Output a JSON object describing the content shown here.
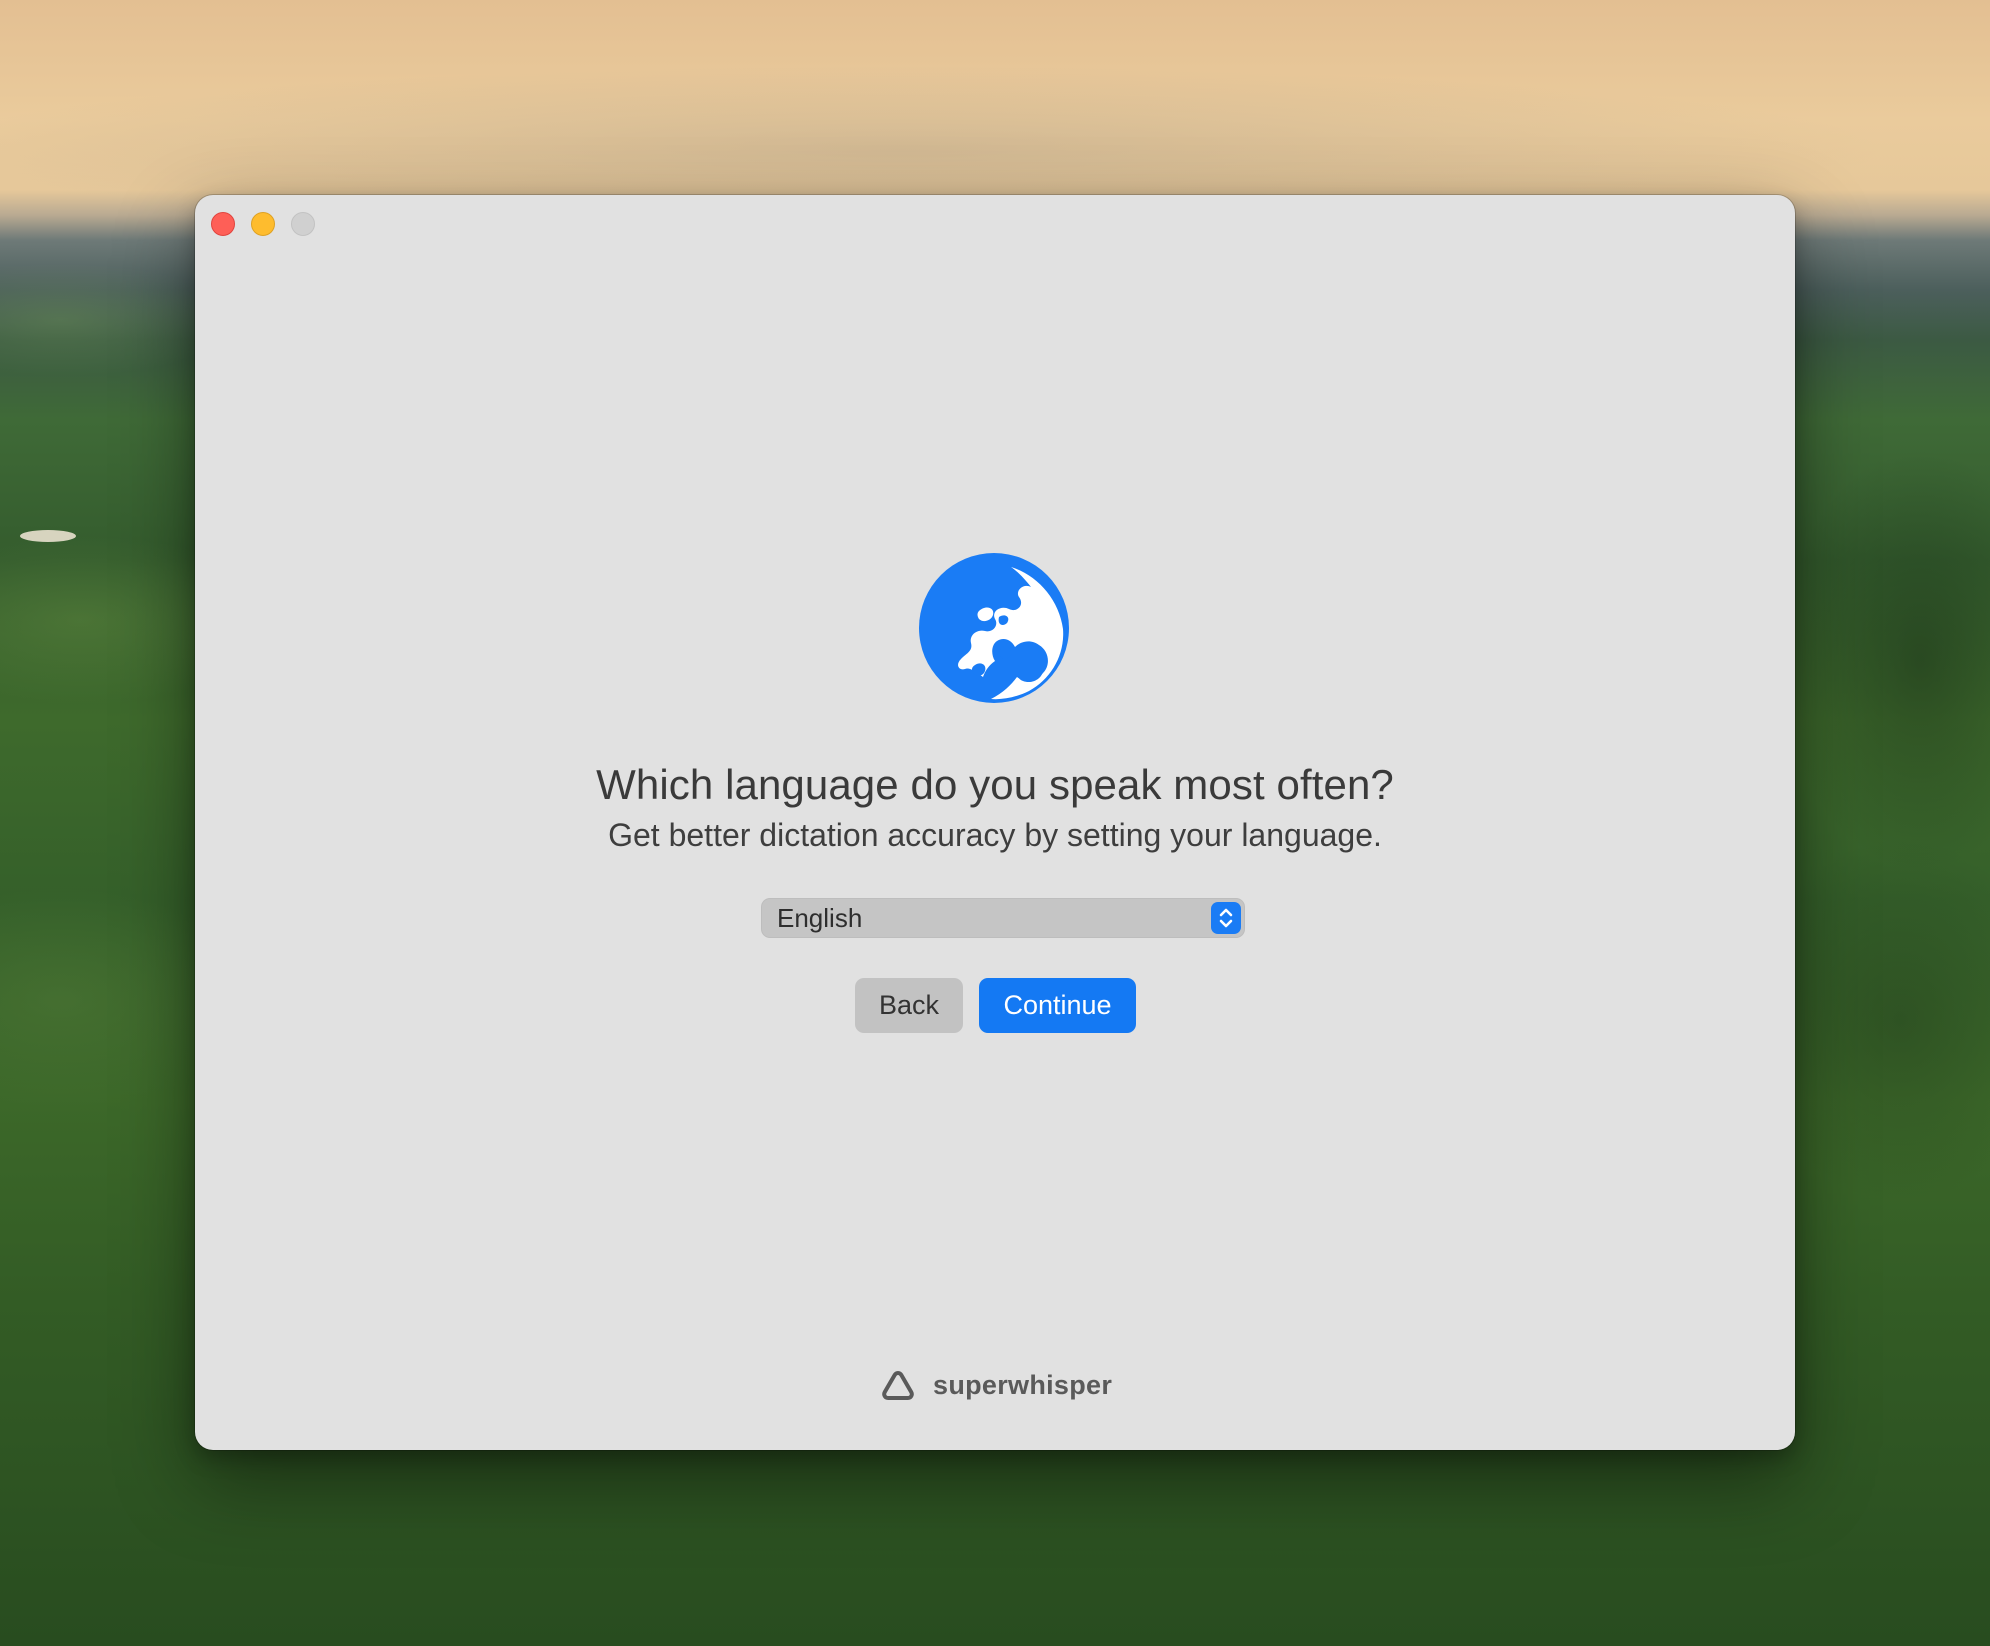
{
  "window": {
    "controls": [
      "close",
      "minimize",
      "zoom"
    ]
  },
  "onboarding": {
    "icon": "globe-icon",
    "title": "Which language do you speak most often?",
    "subtitle": "Get better dictation accuracy by setting your language.",
    "language_select": {
      "selected": "English"
    },
    "back_label": "Back",
    "continue_label": "Continue"
  },
  "footer": {
    "brand_icon": "superwhisper-logo-icon",
    "brand_name": "superwhisper"
  },
  "colors": {
    "accent": "#1479f3",
    "window_background": "#e1e1e1",
    "close": "#fe5f57",
    "minimize": "#febc2e",
    "zoom_disabled": "#d0d0d0"
  }
}
